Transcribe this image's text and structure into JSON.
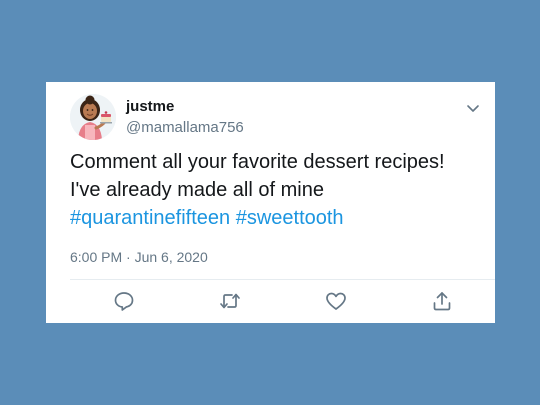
{
  "tweet": {
    "display_name": "justme",
    "handle": "@mamallama756",
    "text": "Comment all your favorite dessert recipes!  I've already made all of mine ",
    "hashtags": [
      "#quarantinefifteen",
      "#sweettooth"
    ],
    "timestamp": "6:00 PM · Jun 6, 2020"
  },
  "icons": {
    "menu": "chevron-down-icon",
    "reply": "reply-icon",
    "retweet": "retweet-icon",
    "like": "heart-icon",
    "share": "share-icon"
  },
  "colors": {
    "background": "#5b8db8",
    "card": "#ffffff",
    "hashtag": "#1b95e0",
    "secondary_text": "#657786",
    "icon": "#657786"
  }
}
